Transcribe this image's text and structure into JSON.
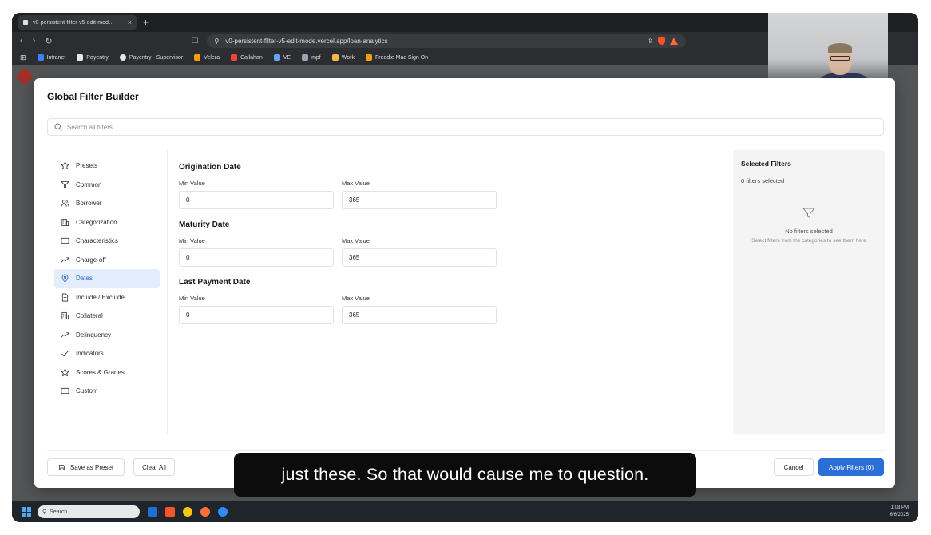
{
  "browser": {
    "tab_title": "v0-persistent-filter-v5-edit-mod…",
    "tab_close": "×",
    "new_tab": "+",
    "url": "v0-persistent-filter-v5-edit-mode.vercel.app/loan-analytics",
    "bookmarks": [
      {
        "label": "Intranet",
        "color": "#3b82f6"
      },
      {
        "label": "Payentry",
        "color": "#e5e7eb"
      },
      {
        "label": "Payentry - Supervisor",
        "color": "#e5e7eb"
      },
      {
        "label": "Velera",
        "color": "#f59e0b"
      },
      {
        "label": "Callahan",
        "color": "#ef4444"
      },
      {
        "label": "VE",
        "color": "#60a5fa"
      },
      {
        "label": "mpf",
        "color": "#9ca3af"
      },
      {
        "label": "Work",
        "color": "#f5b942"
      },
      {
        "label": "Freddie Mac Sign On",
        "color": "#f59e0b"
      }
    ]
  },
  "modal": {
    "title": "Global Filter Builder",
    "search_placeholder": "Search all filters...",
    "categories": [
      {
        "label": "Presets",
        "icon": "star-icon"
      },
      {
        "label": "Common",
        "icon": "filter-icon"
      },
      {
        "label": "Borrower",
        "icon": "users-icon"
      },
      {
        "label": "Categorization",
        "icon": "building-icon"
      },
      {
        "label": "Characteristics",
        "icon": "card-icon"
      },
      {
        "label": "Charge-off",
        "icon": "trend-icon"
      },
      {
        "label": "Dates",
        "icon": "pin-icon",
        "active": true
      },
      {
        "label": "Include / Exclude",
        "icon": "document-icon"
      },
      {
        "label": "Collateral",
        "icon": "building-icon"
      },
      {
        "label": "Delinquency",
        "icon": "trend-icon"
      },
      {
        "label": "Indicators",
        "icon": "check-icon"
      },
      {
        "label": "Scores & Grades",
        "icon": "star-icon"
      },
      {
        "label": "Custom",
        "icon": "card-icon"
      }
    ],
    "sections": [
      {
        "title": "Origination Date",
        "min_label": "Min Value",
        "max_label": "Max Value",
        "min": "0",
        "max": "365"
      },
      {
        "title": "Maturity Date",
        "min_label": "Min Value",
        "max_label": "Max Value",
        "min": "0",
        "max": "365"
      },
      {
        "title": "Last Payment Date",
        "min_label": "Min Value",
        "max_label": "Max Value",
        "min": "0",
        "max": "365"
      }
    ],
    "selected": {
      "title": "Selected Filters",
      "count": "0 filters selected",
      "empty_title": "No filters selected",
      "empty_hint": "Select filters from the categories to see them here"
    },
    "footer": {
      "save_preset": "Save as Preset",
      "clear_all": "Clear All",
      "cancel": "Cancel",
      "apply": "Apply Filters (0)"
    },
    "accent": "#2b6fd6"
  },
  "caption": "just these. So that would cause me to question.",
  "taskbar": {
    "search_placeholder": "Search",
    "time": "1:08 PM",
    "date": "6/6/2025"
  }
}
